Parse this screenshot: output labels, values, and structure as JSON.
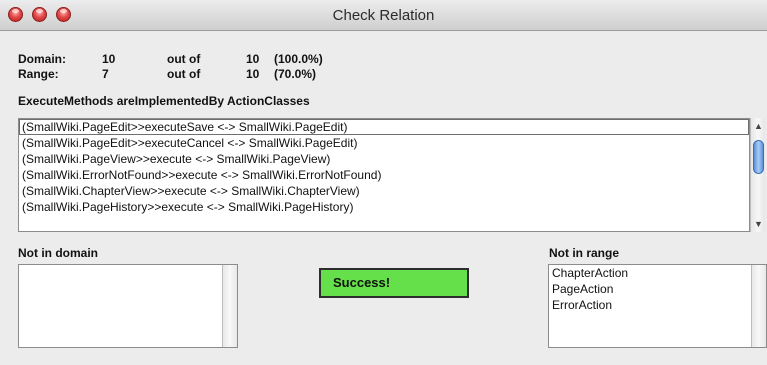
{
  "window": {
    "title": "Check Relation"
  },
  "stats": [
    {
      "label": "Domain:",
      "value": "10",
      "out_of": "out of",
      "total": "10",
      "percent": "(100.0%)"
    },
    {
      "label": "Range:",
      "value": "7",
      "out_of": "out of",
      "total": "10",
      "percent": "(70.0%)"
    }
  ],
  "statement": "ExecuteMethods areImplementedBy ActionClasses",
  "relations": [
    "(SmallWiki.PageEdit>>executeSave <-> SmallWiki.PageEdit)",
    "(SmallWiki.PageEdit>>executeCancel <-> SmallWiki.PageEdit)",
    "(SmallWiki.PageView>>execute <-> SmallWiki.PageView)",
    "(SmallWiki.ErrorNotFound>>execute <-> SmallWiki.ErrorNotFound)",
    "(SmallWiki.ChapterView>>execute <-> SmallWiki.ChapterView)",
    "(SmallWiki.PageHistory>>execute <-> SmallWiki.PageHistory)"
  ],
  "not_in_domain": {
    "heading": "Not in domain",
    "items": []
  },
  "status": {
    "text": "Success!",
    "color": "#66e04a"
  },
  "not_in_range": {
    "heading": "Not in range",
    "items": [
      "ChapterAction",
      "PageAction",
      "ErrorAction"
    ]
  },
  "icons": {
    "scroll_up": "up-arrow-icon",
    "scroll_down": "down-arrow-icon"
  }
}
